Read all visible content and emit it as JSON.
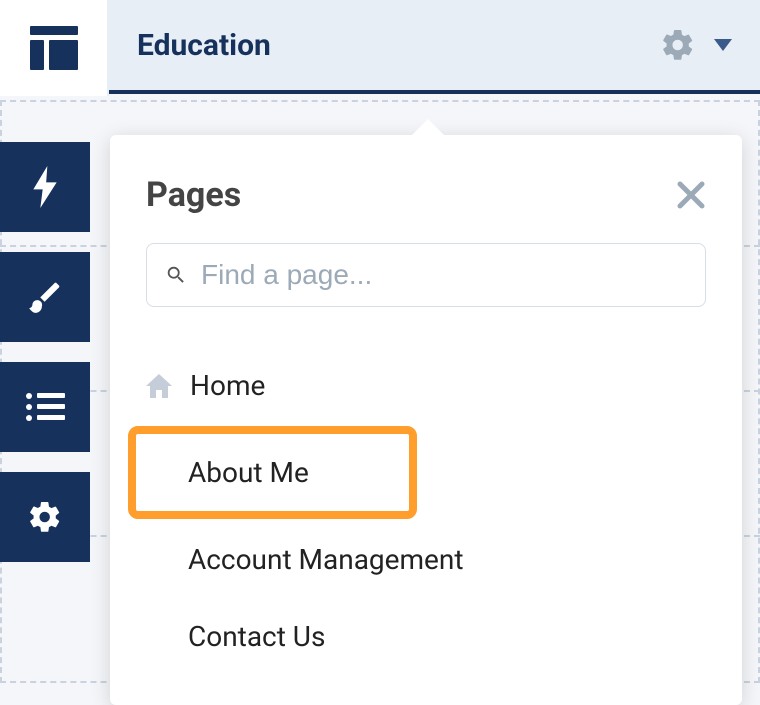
{
  "header": {
    "title": "Education"
  },
  "popover": {
    "title": "Pages",
    "search_placeholder": "Find a page..."
  },
  "pages": {
    "home": "Home",
    "about": "About Me",
    "account": "Account Management",
    "contact": "Contact Us"
  }
}
